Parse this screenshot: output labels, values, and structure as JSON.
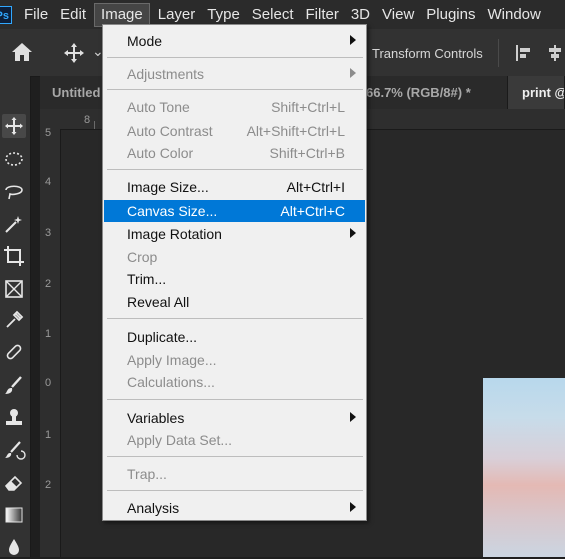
{
  "app": {
    "logo": "Ps"
  },
  "menubar": {
    "items": [
      "File",
      "Edit",
      "Image",
      "Layer",
      "Type",
      "Select",
      "Filter",
      "3D",
      "View",
      "Plugins",
      "Window"
    ],
    "active_index": 2
  },
  "options_bar": {
    "transform_controls_label": "Transform Controls"
  },
  "tabs": {
    "left_tab_label": "Untitled",
    "middle_tab_label": "66.7% (RGB/8#) *",
    "right_tab_label": "print @"
  },
  "rulers": {
    "top_visible_number": "8",
    "left_numbers": [
      "5",
      "4",
      "3",
      "2",
      "1",
      "0",
      "1",
      "2"
    ]
  },
  "image_menu": {
    "items": [
      {
        "label": "Mode",
        "shortcut": "",
        "submenu": true,
        "enabled": true
      },
      {
        "label": "Adjustments",
        "shortcut": "",
        "submenu": true,
        "enabled": false
      },
      {
        "label": "Auto Tone",
        "shortcut": "Shift+Ctrl+L",
        "submenu": false,
        "enabled": false
      },
      {
        "label": "Auto Contrast",
        "shortcut": "Alt+Shift+Ctrl+L",
        "submenu": false,
        "enabled": false
      },
      {
        "label": "Auto Color",
        "shortcut": "Shift+Ctrl+B",
        "submenu": false,
        "enabled": false
      },
      {
        "label": "Image Size...",
        "shortcut": "Alt+Ctrl+I",
        "submenu": false,
        "enabled": true
      },
      {
        "label": "Canvas Size...",
        "shortcut": "Alt+Ctrl+C",
        "submenu": false,
        "enabled": true,
        "highlighted": true
      },
      {
        "label": "Image Rotation",
        "shortcut": "",
        "submenu": true,
        "enabled": true
      },
      {
        "label": "Crop",
        "shortcut": "",
        "submenu": false,
        "enabled": false
      },
      {
        "label": "Trim...",
        "shortcut": "",
        "submenu": false,
        "enabled": true
      },
      {
        "label": "Reveal All",
        "shortcut": "",
        "submenu": false,
        "enabled": true
      },
      {
        "label": "Duplicate...",
        "shortcut": "",
        "submenu": false,
        "enabled": true
      },
      {
        "label": "Apply Image...",
        "shortcut": "",
        "submenu": false,
        "enabled": false
      },
      {
        "label": "Calculations...",
        "shortcut": "",
        "submenu": false,
        "enabled": false
      },
      {
        "label": "Variables",
        "shortcut": "",
        "submenu": true,
        "enabled": true
      },
      {
        "label": "Apply Data Set...",
        "shortcut": "",
        "submenu": false,
        "enabled": false
      },
      {
        "label": "Trap...",
        "shortcut": "",
        "submenu": false,
        "enabled": false
      },
      {
        "label": "Analysis",
        "shortcut": "",
        "submenu": true,
        "enabled": true
      }
    ]
  },
  "toolbar": {
    "tools": [
      "move-icon",
      "marquee-icon",
      "lasso-icon",
      "magic-wand-icon",
      "crop-icon",
      "frame-icon",
      "eyedropper-icon",
      "healing-brush-icon",
      "brush-icon",
      "clone-stamp-icon",
      "history-brush-icon",
      "eraser-icon",
      "gradient-icon",
      "blur-icon"
    ]
  },
  "colors": {
    "highlight": "#0078d7",
    "menu_bg": "#f0f0f0",
    "app_bg": "#323232",
    "ps_blue": "#31a8ff"
  }
}
